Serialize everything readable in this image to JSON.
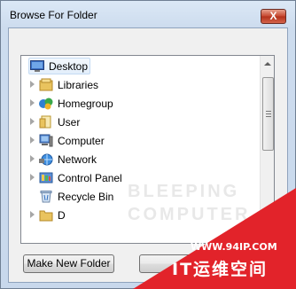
{
  "window": {
    "title": "Browse For Folder",
    "close_glyph": "X"
  },
  "tree": {
    "items": [
      {
        "label": "Desktop",
        "icon": "desktop-icon",
        "expandable": false,
        "selected": true
      },
      {
        "label": "Libraries",
        "icon": "library-icon",
        "expandable": true
      },
      {
        "label": "Homegroup",
        "icon": "homegroup-icon",
        "expandable": true
      },
      {
        "label": "User",
        "icon": "user-folder-icon",
        "expandable": true
      },
      {
        "label": "Computer",
        "icon": "computer-icon",
        "expandable": true
      },
      {
        "label": "Network",
        "icon": "network-icon",
        "expandable": true
      },
      {
        "label": "Control Panel",
        "icon": "control-panel-icon",
        "expandable": true
      },
      {
        "label": "Recycle Bin",
        "icon": "recycle-bin-icon",
        "expandable": false
      },
      {
        "label": "D",
        "icon": "folder-icon",
        "expandable": true
      }
    ]
  },
  "buttons": {
    "make_new_folder": "Make New Folder",
    "ok": ""
  },
  "watermark": {
    "line1": "BLEEPING",
    "line2": "COMPUTER"
  },
  "overlay": {
    "site": "WWW.94IP.COM",
    "brand": "IT运维空间"
  },
  "colors": {
    "overlay_red": "#e2232a",
    "close_red": "#c5452d",
    "selection": "#e3eefb"
  }
}
